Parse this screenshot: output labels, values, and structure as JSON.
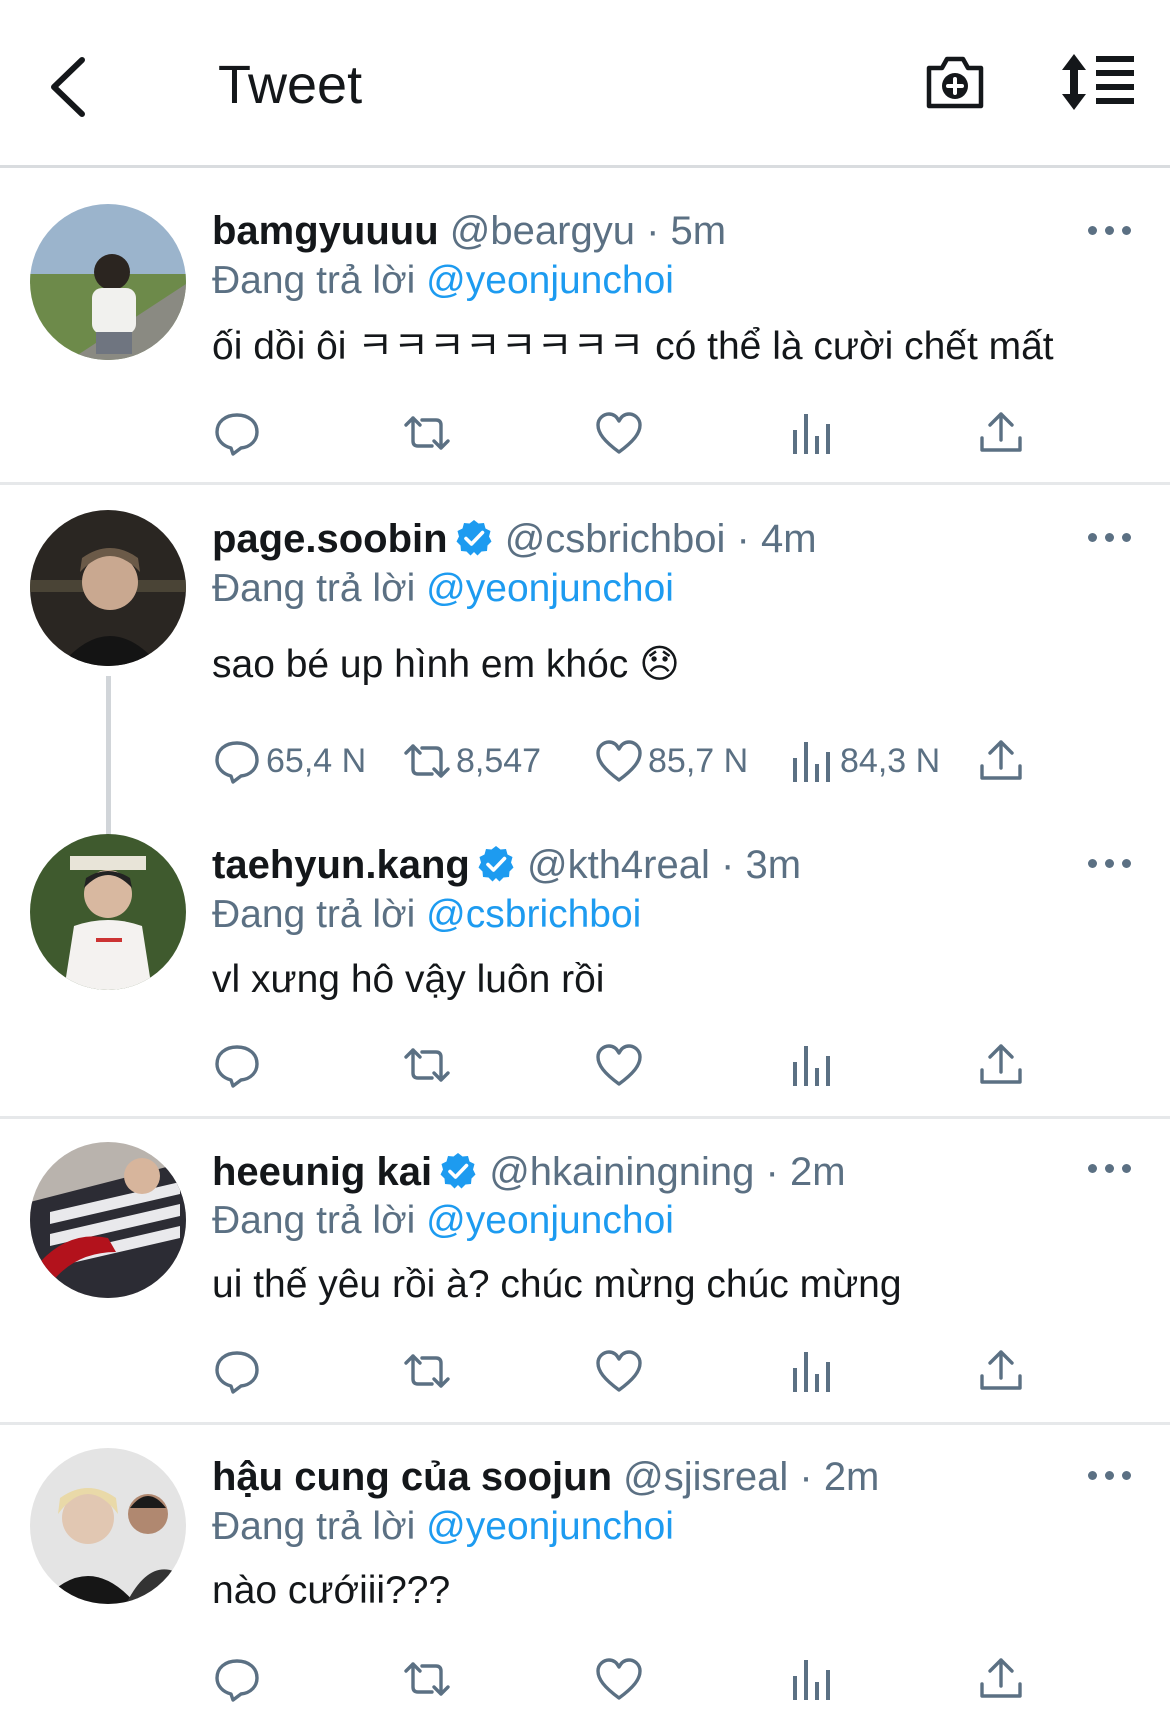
{
  "header": {
    "title": "Tweet"
  },
  "reply_prefix": "Đang trả lời",
  "dot": "·",
  "tweets": [
    {
      "name": "bamgyuuuu",
      "handle": "@beargyu",
      "time": "5m",
      "reply_to": "@yeonjunchoi",
      "text": "ối dồi ôi ㅋㅋㅋㅋㅋㅋㅋㅋ có thể là cười chết mất",
      "verified": false,
      "counts": {
        "reply": "",
        "retweet": "",
        "like": "",
        "views": ""
      }
    },
    {
      "name": "page.soobin",
      "handle": "@csbrichboi",
      "time": "4m",
      "reply_to": "@yeonjunchoi",
      "text": "sao bé up hình em khóc 😞",
      "verified": true,
      "counts": {
        "reply": "65,4 N",
        "retweet": "8,547",
        "like": "85,7 N",
        "views": "84,3 N"
      }
    },
    {
      "name": "taehyun.kang",
      "handle": "@kth4real",
      "time": "3m",
      "reply_to": "@csbrichboi",
      "text": "vl xưng hô vậy luôn rồi",
      "verified": true,
      "counts": {
        "reply": "",
        "retweet": "",
        "like": "",
        "views": ""
      }
    },
    {
      "name": "heeunig kai",
      "handle": "@hkainingning",
      "time": "2m",
      "reply_to": "@yeonjunchoi",
      "text": "ui thế yêu rồi à? chúc mừng chúc mừng",
      "verified": true,
      "counts": {
        "reply": "",
        "retweet": "",
        "like": "",
        "views": ""
      }
    },
    {
      "name": "hậu cung của soojun",
      "handle": "@sjisreal",
      "time": "2m",
      "reply_to": "@yeonjunchoi",
      "text": "nào cướiii???",
      "verified": false,
      "counts": {
        "reply": "",
        "retweet": "",
        "like": "",
        "views": ""
      }
    }
  ],
  "colors": {
    "accent": "#1d9bf0",
    "muted": "#5b7083",
    "text": "#14171a"
  },
  "icons": [
    "back-arrow-icon",
    "camera-plus-icon",
    "sort-icon",
    "more-icon",
    "verified-badge-icon",
    "reply-icon",
    "retweet-icon",
    "like-icon",
    "views-icon",
    "share-icon"
  ]
}
